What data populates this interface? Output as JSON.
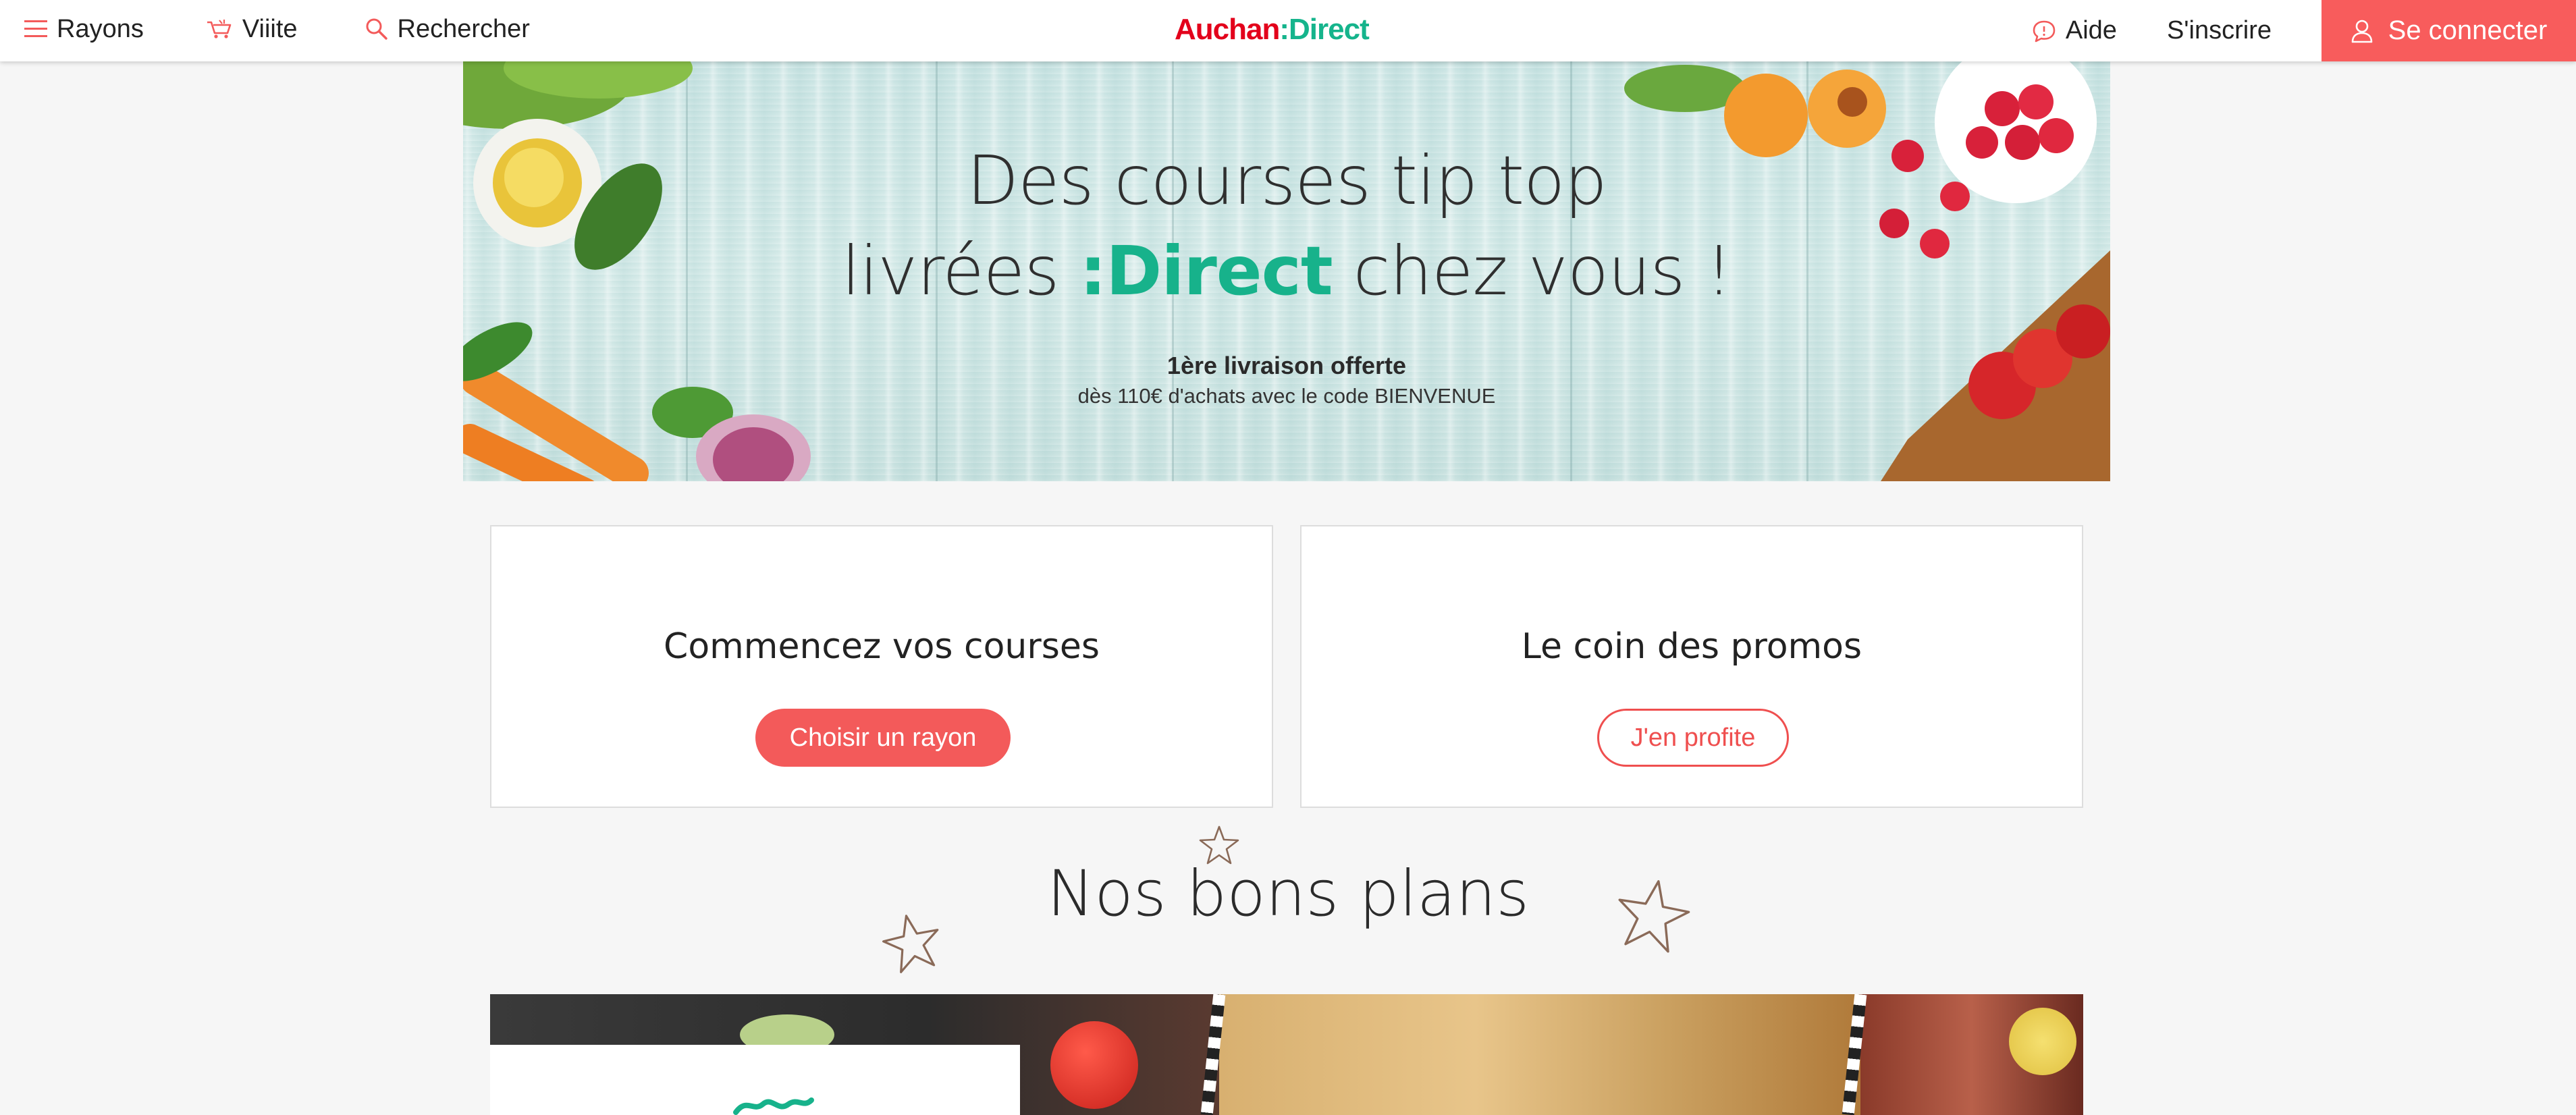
{
  "header": {
    "nav_left": [
      {
        "label": "Rayons",
        "icon": "menu-icon"
      },
      {
        "label": "Viiite",
        "icon": "cart-icon"
      },
      {
        "label": "Rechercher",
        "icon": "search-icon"
      }
    ],
    "logo": {
      "part1": "Auchan",
      "separator": ":",
      "part2": "Direct"
    },
    "nav_right": [
      {
        "label": "Aide",
        "icon": "chat-bubble-icon"
      },
      {
        "label": "S'inscrire"
      }
    ],
    "login_label": "Se connecter"
  },
  "hero": {
    "title_line1": "Des courses tip top",
    "title_line2_before": "livrées ",
    "title_line2_accent": ":Direct",
    "title_line2_after": " chez vous !",
    "subtitle_bold": "1ère livraison offerte",
    "subtitle": "dès 110€ d'achats avec le code BIENVENUE"
  },
  "cards": [
    {
      "title": "Commencez vos courses",
      "button": "Choisir un rayon"
    },
    {
      "title": "Le coin des promos",
      "button": "J'en profite"
    }
  ],
  "section": {
    "title": "Nos bons plans"
  },
  "colors": {
    "accent_red": "#f35a5a",
    "brand_green": "#17b28b",
    "brand_red": "#e3001b"
  }
}
